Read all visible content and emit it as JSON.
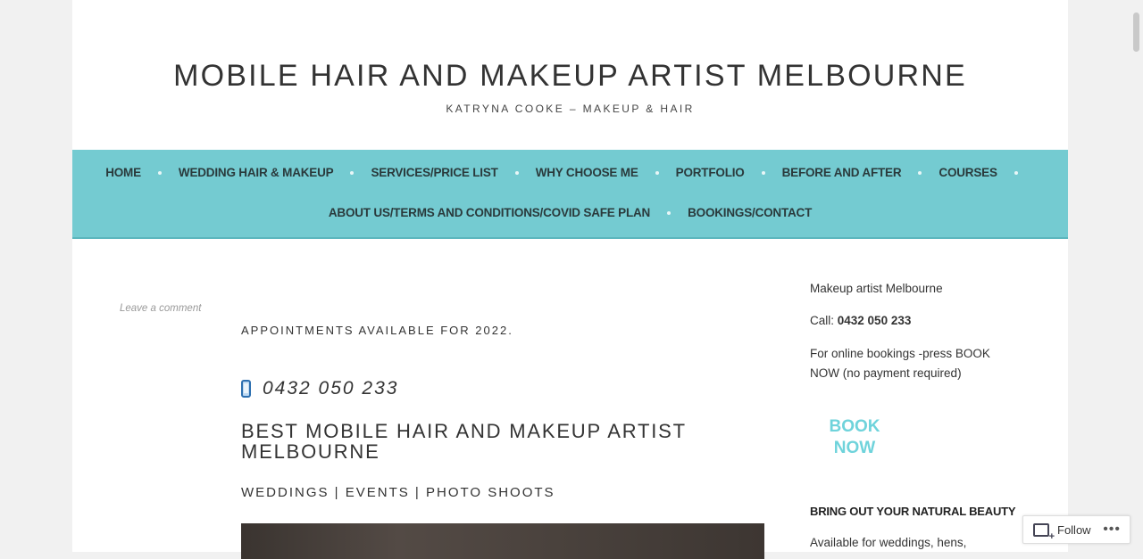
{
  "header": {
    "site_title": "MOBILE HAIR AND MAKEUP ARTIST MELBOURNE",
    "tagline": "KATRYNA COOKE – MAKEUP & HAIR"
  },
  "nav": {
    "row1": [
      "HOME",
      "WEDDING HAIR & MAKEUP",
      "SERVICES/PRICE LIST",
      "WHY CHOOSE ME",
      "PORTFOLIO",
      "BEFORE AND AFTER",
      "COURSES"
    ],
    "row2": [
      "ABOUT US/TERMS AND CONDITIONS/COVID SAFE PLAN",
      "BOOKINGS/CONTACT"
    ]
  },
  "post": {
    "leave_comment": "Leave a comment",
    "appointments": "APPOINTMENTS AVAILABLE FOR 2022.",
    "phone": "0432 050 233",
    "heading": "BEST MOBILE HAIR AND MAKEUP ARTIST MELBOURNE",
    "services": "WEDDINGS | EVENTS | PHOTO SHOOTS"
  },
  "sidebar": {
    "title": "Makeup artist Melbourne",
    "call_label": "Call: ",
    "call_number": "0432 050 233",
    "online_text": "For online bookings -press BOOK NOW (no payment required)",
    "book_now": "BOOK NOW",
    "heading": "BRING OUT YOUR NATURAL BEAUTY",
    "available": "Available for weddings, hens,"
  },
  "follow": {
    "label": "Follow",
    "more": "•••"
  },
  "colors": {
    "nav_bg": "#74cbd1",
    "book_now": "#6fd3db"
  }
}
